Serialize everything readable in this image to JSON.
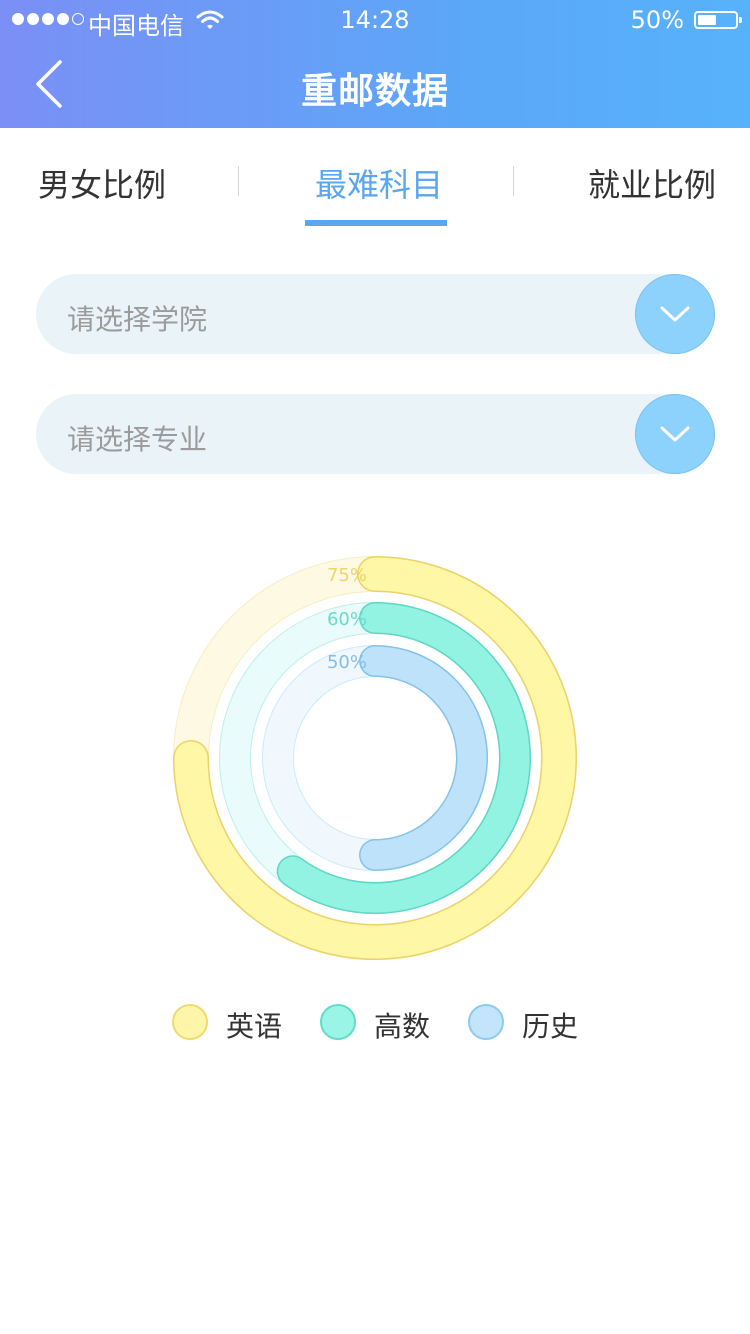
{
  "status_bar": {
    "carrier": "中国电信",
    "time": "14:28",
    "battery": "50%"
  },
  "header": {
    "title": "重邮数据",
    "back_icon": "chevron-left-icon"
  },
  "tabs": [
    {
      "label": "男女比例",
      "active": false
    },
    {
      "label": "最难科目",
      "active": true
    },
    {
      "label": "就业比例",
      "active": false
    }
  ],
  "filters": {
    "college_placeholder": "请选择学院",
    "major_placeholder": "请选择专业",
    "dropdown_icon": "chevron-down-icon"
  },
  "chart_data": {
    "type": "radial-bar",
    "unit": "%",
    "series": [
      {
        "name": "英语",
        "value": 75,
        "label": "75%",
        "color": "#fdf49a"
      },
      {
        "name": "高数",
        "value": 60,
        "label": "60%",
        "color": "#7ff1de"
      },
      {
        "name": "历史",
        "value": 50,
        "label": "50%",
        "color": "#b6def9"
      }
    ],
    "max": 100,
    "legend": "bottom"
  },
  "colors": {
    "accent": "#5aa6f0",
    "header_start": "#7b8ff6",
    "header_end": "#58b2fb"
  }
}
